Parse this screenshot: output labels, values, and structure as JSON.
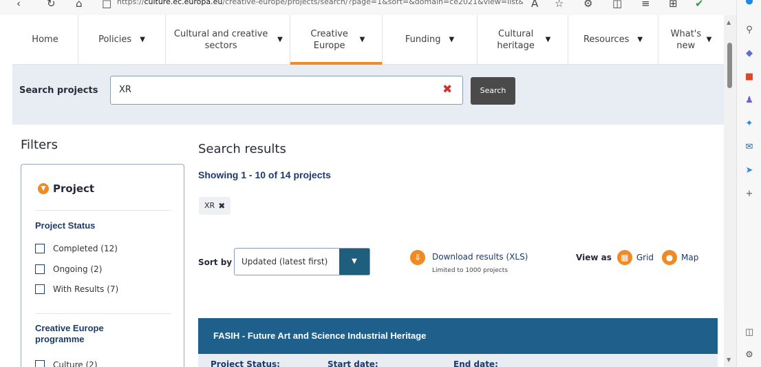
{
  "browser": {
    "url_prefix": "https://",
    "url_host": "culture.ec.europa.eu",
    "url_rest": "/creative-europe/projects/search/?page=1&sort=&domain=ce2021&view=list&..."
  },
  "nav": {
    "items": [
      {
        "label": "Home",
        "has_caret": false
      },
      {
        "label": "Policies",
        "has_caret": true
      },
      {
        "label": "Cultural and creative sectors",
        "has_caret": true
      },
      {
        "label": "Creative Europe",
        "has_caret": true,
        "active": true
      },
      {
        "label": "Funding",
        "has_caret": true
      },
      {
        "label": "Cultural heritage",
        "has_caret": true
      },
      {
        "label": "Resources",
        "has_caret": true
      },
      {
        "label": "What's new",
        "has_caret": true
      }
    ]
  },
  "search": {
    "label": "Search projects",
    "value": "XR",
    "button_label": "Search"
  },
  "filters": {
    "title": "Filters",
    "section_title": "Project",
    "status_group": "Project Status",
    "status_options": [
      {
        "label": "Completed (12)"
      },
      {
        "label": "Ongoing (2)"
      },
      {
        "label": "With Results (7)"
      }
    ],
    "programme_group": "Creative Europe programme",
    "programme_options": [
      {
        "label": "Culture (2)"
      }
    ]
  },
  "results": {
    "title": "Search results",
    "showing": "Showing 1 - 10 of 14 projects",
    "chip_label": "XR",
    "sort_label": "Sort by",
    "sort_value": "Updated (latest first)",
    "download_label": "Download results (XLS)",
    "download_note": "Limited to 1000 projects",
    "view_as_label": "View as",
    "grid_label": "Grid",
    "map_label": "Map",
    "first_result": {
      "title": "FASIH - Future Art and Science Industrial Heritage",
      "status_label": "Project Status:",
      "start_label": "Start date:",
      "end_label": "End date:"
    }
  },
  "colors": {
    "accent_orange": "#f08a24",
    "navy": "#1d3a6c",
    "card_header": "#1f5f8b",
    "search_band": "#e8edf4"
  }
}
